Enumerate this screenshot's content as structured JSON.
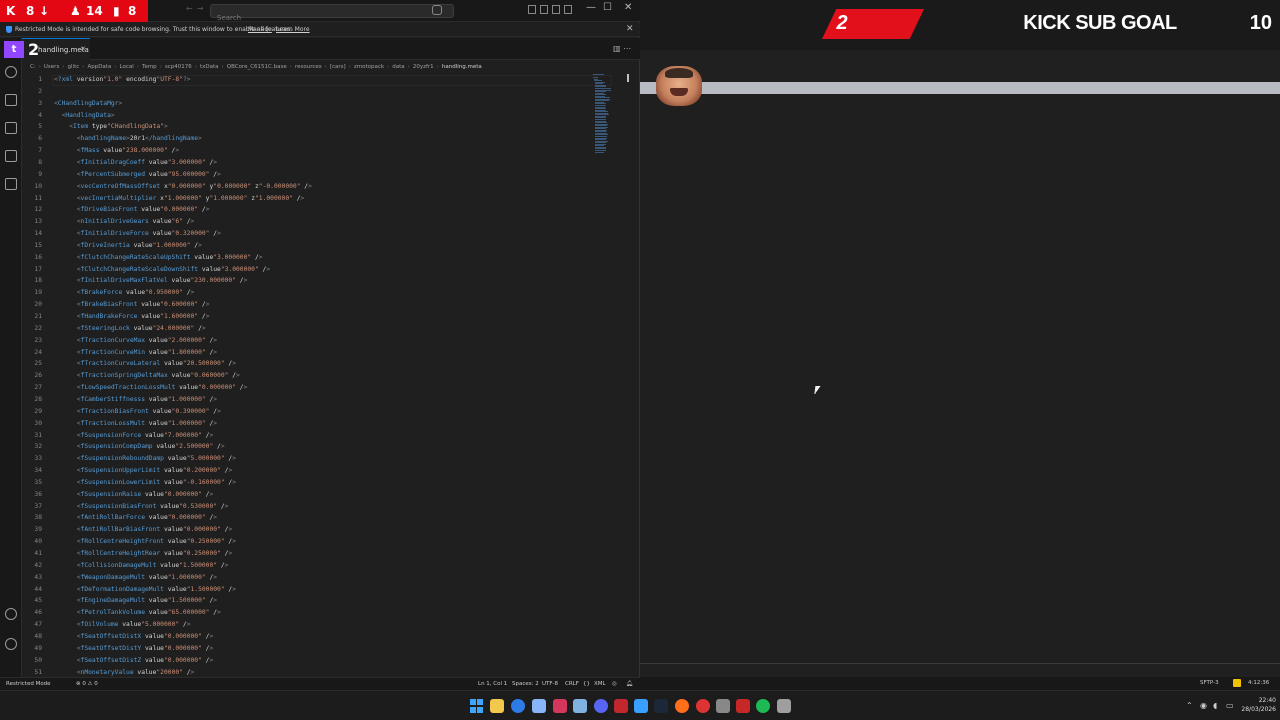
{
  "stream": {
    "badges": [
      {
        "icon": "kick-icon",
        "value": "8",
        "arrow": "↓"
      },
      {
        "icon": "person-icon",
        "value": "14"
      },
      {
        "icon": "bars-icon",
        "value": "8"
      }
    ],
    "twitch_count": "2",
    "goal": {
      "current": "2",
      "title": "KICK SUB GOAL",
      "target": "10"
    }
  },
  "vscode": {
    "search_placeholder": "Search",
    "restricted": {
      "message": "Restricted Mode is intended for safe code browsing. Trust this window to enable all features.",
      "manage": "Manage",
      "learn_more": "Learn More"
    },
    "tab": {
      "label": "handling.meta"
    },
    "breadcrumb": [
      "C:",
      "Users",
      "glitc",
      "AppData",
      "Local",
      "Temp",
      "scp40176",
      "txData",
      "QBCore_C6151C.base",
      "resources",
      "[cars]",
      "zmotopack",
      "data",
      "20yzfr1",
      "handling.meta"
    ],
    "lines": [
      {
        "n": "1",
        "t": "<?xml version=\"1.0\" encoding=\"UTF-8\"?>"
      },
      {
        "n": "2",
        "t": ""
      },
      {
        "n": "3",
        "t": "<CHandlingDataMgr>"
      },
      {
        "n": "4",
        "t": "  <HandlingData>"
      },
      {
        "n": "5",
        "t": "    <Item type=\"CHandlingData\">"
      },
      {
        "n": "6",
        "t": "      <handlingName>20r1</handlingName>"
      },
      {
        "n": "7",
        "t": "      <fMass value=\"238.000000\" />"
      },
      {
        "n": "8",
        "t": "      <fInitialDragCoeff value=\"3.000000\" />"
      },
      {
        "n": "9",
        "t": "      <fPercentSubmerged value=\"95.000000\" />"
      },
      {
        "n": "10",
        "t": "      <vecCentreOfMassOffset x=\"0.000000\" y=\"0.000000\" z=\"-0.000000\" />"
      },
      {
        "n": "11",
        "t": "      <vecInertiaMultiplier x=\"1.000000\" y=\"1.000000\" z=\"1.000000\" />"
      },
      {
        "n": "12",
        "t": "      <fDriveBiasFront value=\"0.000000\" />"
      },
      {
        "n": "13",
        "t": "      <nInitialDriveGears value=\"6\" />"
      },
      {
        "n": "14",
        "t": "      <fInitialDriveForce value=\"0.320000\" />"
      },
      {
        "n": "15",
        "t": "      <fDriveInertia value=\"1.000000\" />"
      },
      {
        "n": "16",
        "t": "      <fClutchChangeRateScaleUpShift value=\"3.000000\" />"
      },
      {
        "n": "17",
        "t": "      <fClutchChangeRateScaleDownShift value=\"3.000000\" />"
      },
      {
        "n": "18",
        "t": "      <fInitialDriveMaxFlatVel value=\"230.000000\" />"
      },
      {
        "n": "19",
        "t": "      <fBrakeForce value=\"0.950000\" />"
      },
      {
        "n": "20",
        "t": "      <fBrakeBiasFront value=\"0.600000\" />"
      },
      {
        "n": "21",
        "t": "      <fHandBrakeForce value=\"1.600000\" />"
      },
      {
        "n": "22",
        "t": "      <fSteeringLock value=\"24.000000\" />"
      },
      {
        "n": "23",
        "t": "      <fTractionCurveMax value=\"2.000000\" />"
      },
      {
        "n": "24",
        "t": "      <fTractionCurveMin value=\"1.800000\" />"
      },
      {
        "n": "25",
        "t": "      <fTractionCurveLateral value=\"20.500000\" />"
      },
      {
        "n": "26",
        "t": "      <fTractionSpringDeltaMax value=\"0.060000\" />"
      },
      {
        "n": "27",
        "t": "      <fLowSpeedTractionLossMult value=\"0.000000\" />"
      },
      {
        "n": "28",
        "t": "      <fCamberStiffnesss value=\"1.000000\" />"
      },
      {
        "n": "29",
        "t": "      <fTractionBiasFront value=\"0.390000\" />"
      },
      {
        "n": "30",
        "t": "      <fTractionLossMult value=\"1.000000\" />"
      },
      {
        "n": "31",
        "t": "      <fSuspensionForce value=\"7.000000\" />"
      },
      {
        "n": "32",
        "t": "      <fSuspensionCompDamp value=\"2.500000\" />"
      },
      {
        "n": "33",
        "t": "      <fSuspensionReboundDamp value=\"5.000000\" />"
      },
      {
        "n": "34",
        "t": "      <fSuspensionUpperLimit value=\"0.200000\" />"
      },
      {
        "n": "35",
        "t": "      <fSuspensionLowerLimit value=\"-0.160000\" />"
      },
      {
        "n": "36",
        "t": "      <fSuspensionRaise value=\"0.000000\" />"
      },
      {
        "n": "37",
        "t": "      <fSuspensionBiasFront value=\"0.530000\" />"
      },
      {
        "n": "38",
        "t": "      <fAntiRollBarForce value=\"0.000000\" />"
      },
      {
        "n": "39",
        "t": "      <fAntiRollBarBiasFront value=\"0.000000\" />"
      },
      {
        "n": "40",
        "t": "      <fRollCentreHeightFront value=\"0.250000\" />"
      },
      {
        "n": "41",
        "t": "      <fRollCentreHeightRear value=\"0.250000\" />"
      },
      {
        "n": "42",
        "t": "      <fCollisionDamageMult value=\"1.500000\" />"
      },
      {
        "n": "43",
        "t": "      <fWeaponDamageMult value=\"1.000000\" />"
      },
      {
        "n": "44",
        "t": "      <fDeformationDamageMult value=\"1.500000\" />"
      },
      {
        "n": "45",
        "t": "      <fEngineDamageMult value=\"1.500000\" />"
      },
      {
        "n": "46",
        "t": "      <fPetrolTankVolume value=\"65.000000\" />"
      },
      {
        "n": "47",
        "t": "      <fOilVolume value=\"5.000000\" />"
      },
      {
        "n": "48",
        "t": "      <fSeatOffsetDistX value=\"0.000000\" />"
      },
      {
        "n": "49",
        "t": "      <fSeatOffsetDistY value=\"0.000000\" />"
      },
      {
        "n": "50",
        "t": "      <fSeatOffsetDistZ value=\"0.000000\" />"
      },
      {
        "n": "51",
        "t": "      <nMonetaryValue value=\"20000\" />"
      }
    ],
    "status": {
      "restricted": "Restricted Mode",
      "problems": "⊗ 0 ⚠ 0",
      "position": "Ln 1, Col 1",
      "spaces": "Spaces: 2",
      "encoding": "UTF-8",
      "eol": "CRLF",
      "braces": "{}",
      "language": "XML"
    }
  },
  "right_status": {
    "left": "SFTP-3",
    "right": "4:12:36"
  },
  "taskbar": {
    "icons": [
      "windows-start-icon",
      "search-icon",
      "file-explorer-icon",
      "edge-icon",
      "browser-icon",
      "vscode-icon",
      "xmind-icon",
      "terminal-icon",
      "discord-icon",
      "app-icon",
      "app-icon-2",
      "steam-icon",
      "obs-icon",
      "app-icon-3",
      "app-icon-4",
      "app-icon-5",
      "app-icon-6",
      "spotify-icon",
      "notepad-icon"
    ],
    "time": "22:40",
    "date": "28/03/2026"
  },
  "colors": {
    "goal_red": "#e2101a",
    "kick_red": "#e30613",
    "twitch_purple": "#9147ff",
    "accent_blue": "#0078d4"
  }
}
